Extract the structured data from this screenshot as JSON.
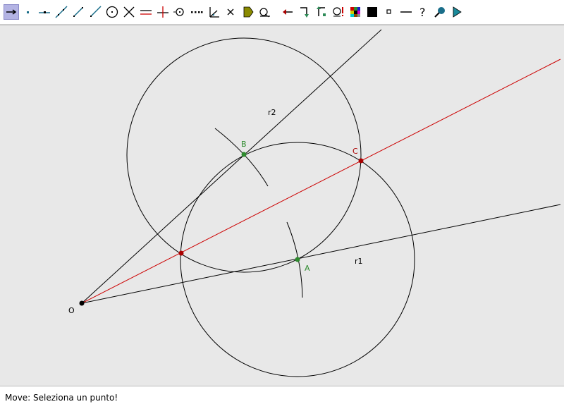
{
  "toolbar": {
    "tools": [
      {
        "name": "move-tool-icon",
        "selected": true
      },
      {
        "name": "point-tool-icon"
      },
      {
        "name": "point-on-line-tool-icon"
      },
      {
        "name": "line-tool-icon"
      },
      {
        "name": "segment-tool-icon"
      },
      {
        "name": "ray-tool-icon"
      },
      {
        "name": "circle-tool-icon"
      },
      {
        "name": "intersection-tool-icon"
      },
      {
        "name": "parallel-tool-icon"
      },
      {
        "name": "perpendicular-tool-icon"
      },
      {
        "name": "midpoint-tool-icon"
      },
      {
        "name": "locus-tool-icon"
      },
      {
        "name": "angle-tool-icon"
      },
      {
        "name": "delete-tool-icon"
      },
      {
        "name": "label-tool-icon"
      },
      {
        "name": "measure-tool-icon"
      },
      {
        "name": "undo-arrow-icon"
      },
      {
        "name": "macro-start-icon"
      },
      {
        "name": "macro-end-icon"
      },
      {
        "name": "macro-run-icon"
      },
      {
        "name": "color-palette-icon"
      },
      {
        "name": "fill-black-icon"
      },
      {
        "name": "point-style-icon"
      },
      {
        "name": "line-style-icon"
      },
      {
        "name": "help-icon"
      },
      {
        "name": "zoom-icon"
      },
      {
        "name": "play-icon"
      }
    ]
  },
  "canvas": {
    "colors": {
      "black": "#000000",
      "red": "#cc0000",
      "green": "#2e8b2e",
      "darkred": "#aa0000"
    },
    "labels": {
      "O": "O",
      "A": "A",
      "B": "B",
      "C": "C",
      "r1": "r1",
      "r2": "r2"
    }
  },
  "status": {
    "message": "Move: Seleziona un punto!"
  }
}
